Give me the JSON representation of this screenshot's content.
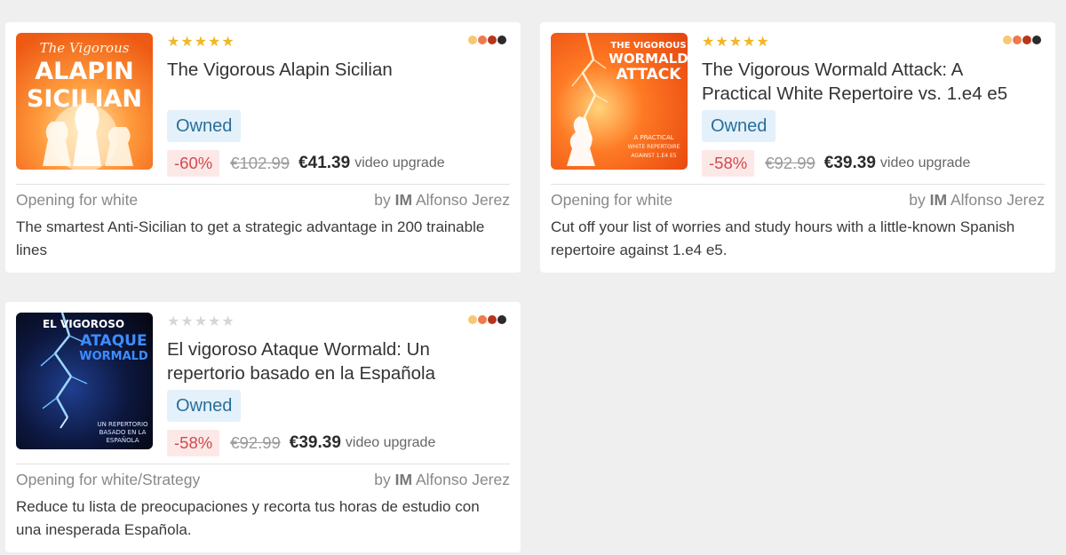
{
  "star_glyph": "★",
  "colors": {
    "star_filled": "#f1b724",
    "star_empty": "#d6d6d6",
    "owned_bg": "#e4f1fa",
    "owned_text": "#2a6e9a",
    "discount_bg": "#fde8e8",
    "discount_text": "#d14b4b",
    "dot_colors": [
      "#f7c873",
      "#ee7a4d",
      "#b8361c",
      "#2b2b2b"
    ]
  },
  "cards": [
    {
      "cover": {
        "line1": "The Vigorous",
        "line2": "ALAPIN",
        "line3": "SICILIAN"
      },
      "rating_stars": 5,
      "title": "The Vigorous Alapin Sicilian",
      "owned_label": "Owned",
      "discount": "-60%",
      "old_price": "€102.99",
      "new_price": "€41.39",
      "upgrade_label": "video upgrade",
      "category": "Opening for white",
      "author_prefix": "by",
      "author_title": "IM",
      "author_name": "Alfonso Jerez",
      "description": "The smartest Anti-Sicilian to get a strategic advantage in 200 trainable lines"
    },
    {
      "cover": {
        "line1": "THE VIGOROUS",
        "line2": "WORMALD",
        "line3": "ATTACK",
        "sub1": "A PRACTICAL",
        "sub2": "WHITE REPERTOIRE",
        "sub3": "AGAINST 1.E4 E5"
      },
      "rating_stars": 5,
      "title": "The Vigorous Wormald Attack: A Practical White Repertoire vs. 1.e4 e5",
      "owned_label": "Owned",
      "discount": "-58%",
      "old_price": "€92.99",
      "new_price": "€39.39",
      "upgrade_label": "video upgrade",
      "category": "Opening for white",
      "author_prefix": "by",
      "author_title": "IM",
      "author_name": "Alfonso Jerez",
      "description": "Cut off your list of worries and study hours with a little-known Spanish repertoire against 1.e4 e5."
    },
    {
      "cover": {
        "line1": "EL VIGOROSO",
        "line2": "ATAQUE",
        "line3": "WORMALD",
        "sub1": "UN REPERTORIO",
        "sub2": "BASADO EN LA",
        "sub3": "ESPAÑOLA"
      },
      "rating_stars": 0,
      "title": "El vigoroso Ataque Wormald: Un repertorio basado en la Española",
      "owned_label": "Owned",
      "discount": "-58%",
      "old_price": "€92.99",
      "new_price": "€39.39",
      "upgrade_label": "video upgrade",
      "category": "Opening for white/Strategy",
      "author_prefix": "by",
      "author_title": "IM",
      "author_name": "Alfonso Jerez",
      "description": "Reduce tu lista de preocupaciones y recorta tus horas de estudio con una inesperada Española."
    }
  ]
}
